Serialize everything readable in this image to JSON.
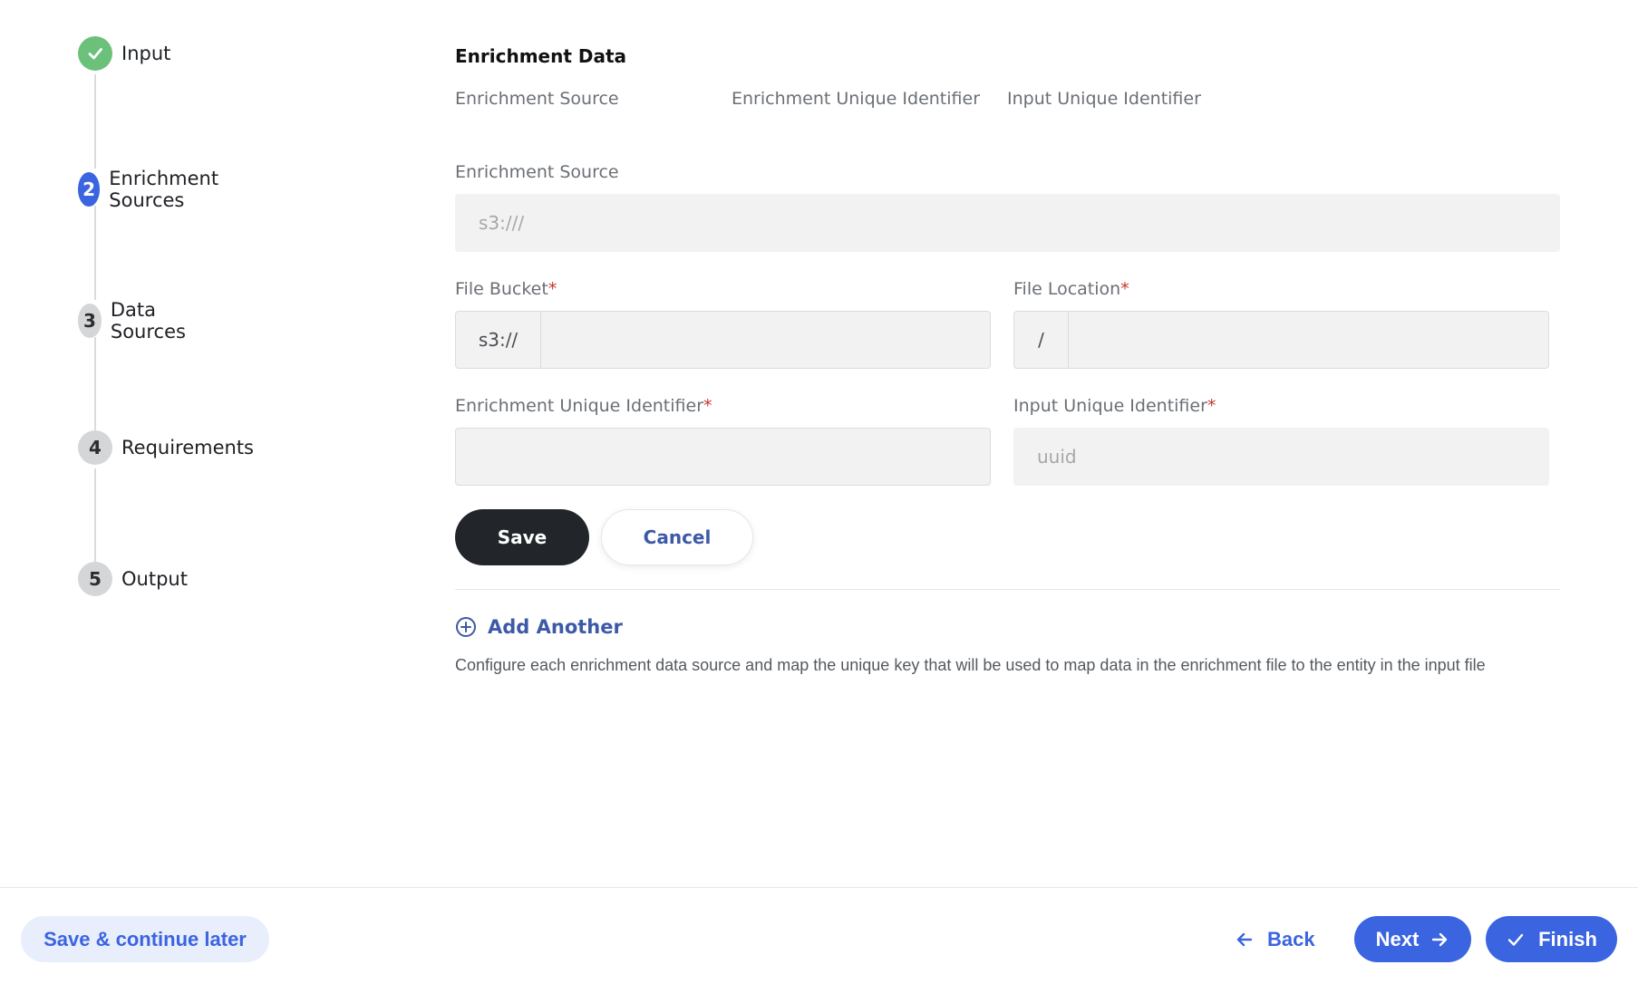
{
  "stepper": {
    "steps": [
      {
        "number": "",
        "label": "Input",
        "state": "completed",
        "icon": "check-icon"
      },
      {
        "number": "2",
        "label": "Enrichment Sources",
        "state": "active"
      },
      {
        "number": "3",
        "label": "Data Sources",
        "state": "pending"
      },
      {
        "number": "4",
        "label": "Requirements",
        "state": "pending"
      },
      {
        "number": "5",
        "label": "Output",
        "state": "pending"
      }
    ]
  },
  "main": {
    "title": "Enrichment Data",
    "columns": [
      "Enrichment Source",
      "Enrichment Unique Identifier",
      "Input Unique Identifier"
    ],
    "form": {
      "enrichment_source": {
        "label": "Enrichment Source",
        "placeholder": "s3:///",
        "value": ""
      },
      "file_bucket": {
        "label": "File Bucket",
        "required_mark": "*",
        "prefix": "s3://",
        "value": ""
      },
      "file_location": {
        "label": "File Location",
        "required_mark": "*",
        "prefix": "/",
        "value": ""
      },
      "enrichment_uid": {
        "label": "Enrichment Unique Identifier",
        "required_mark": "*",
        "value": ""
      },
      "input_uid": {
        "label": "Input Unique Identifier",
        "required_mark": "*",
        "placeholder": "uuid",
        "value": ""
      }
    },
    "save_label": "Save",
    "cancel_label": "Cancel",
    "add_another_label": "Add Another",
    "helper_text": "Configure each enrichment data source and map the unique key that will be used to map data in the enrichment file to the entity in the input file"
  },
  "footer": {
    "save_later_label": "Save & continue later",
    "back_label": "Back",
    "next_label": "Next",
    "finish_label": "Finish"
  },
  "colors": {
    "primary": "#3b64e0",
    "success": "#6cc17a",
    "dark_button": "#22262b",
    "required": "#c0392b"
  }
}
